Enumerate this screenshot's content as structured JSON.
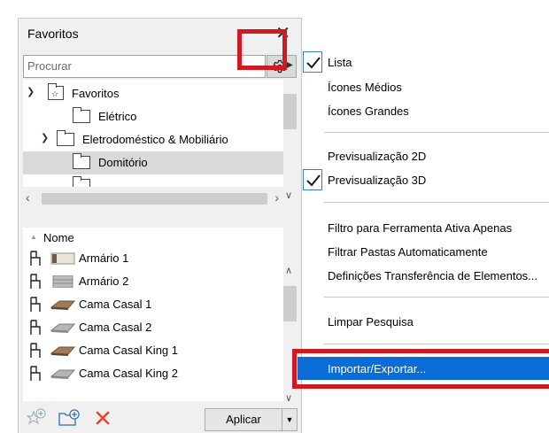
{
  "panel": {
    "title": "Favoritos",
    "search_placeholder": "Procurar",
    "tree": [
      {
        "label": "Favoritos",
        "expanded": true
      },
      {
        "label": "Elétrico"
      },
      {
        "label": "Eletrodoméstico & Mobiliário",
        "expanded": true
      },
      {
        "label": "Domitório",
        "selected": true
      }
    ],
    "list_header": "Nome",
    "items": [
      {
        "label": "Armário 1",
        "thumb": "wardrobe-icon"
      },
      {
        "label": "Armário 2",
        "thumb": "cabinet-icon"
      },
      {
        "label": "Cama Casal 1",
        "thumb": "bed-icon"
      },
      {
        "label": "Cama Casal 2",
        "thumb": "bed-icon"
      },
      {
        "label": "Cama Casal King 1",
        "thumb": "bed-icon"
      },
      {
        "label": "Cama Casal King 2",
        "thumb": "bed-icon"
      }
    ],
    "apply_label": "Aplicar"
  },
  "menu": {
    "items": [
      {
        "label": "Lista",
        "checked": true
      },
      {
        "label": "Ícones Médios"
      },
      {
        "label": "Ícones Grandes"
      },
      {
        "label": "Previsualização 2D"
      },
      {
        "label": "Previsualização 3D",
        "checked": true
      },
      {
        "label": "Filtro para Ferramenta Ativa Apenas"
      },
      {
        "label": "Filtrar Pastas Automaticamente"
      },
      {
        "label": "Definições Transferência de Elementos..."
      },
      {
        "label": "Limpar Pesquisa"
      },
      {
        "label": "Importar/Exportar...",
        "highlighted": true
      }
    ]
  },
  "colors": {
    "highlight": "#0a6cd6",
    "annotation_red": "#d11922",
    "delete_red": "#e8472b",
    "accent_blue": "#2a6fb8"
  }
}
